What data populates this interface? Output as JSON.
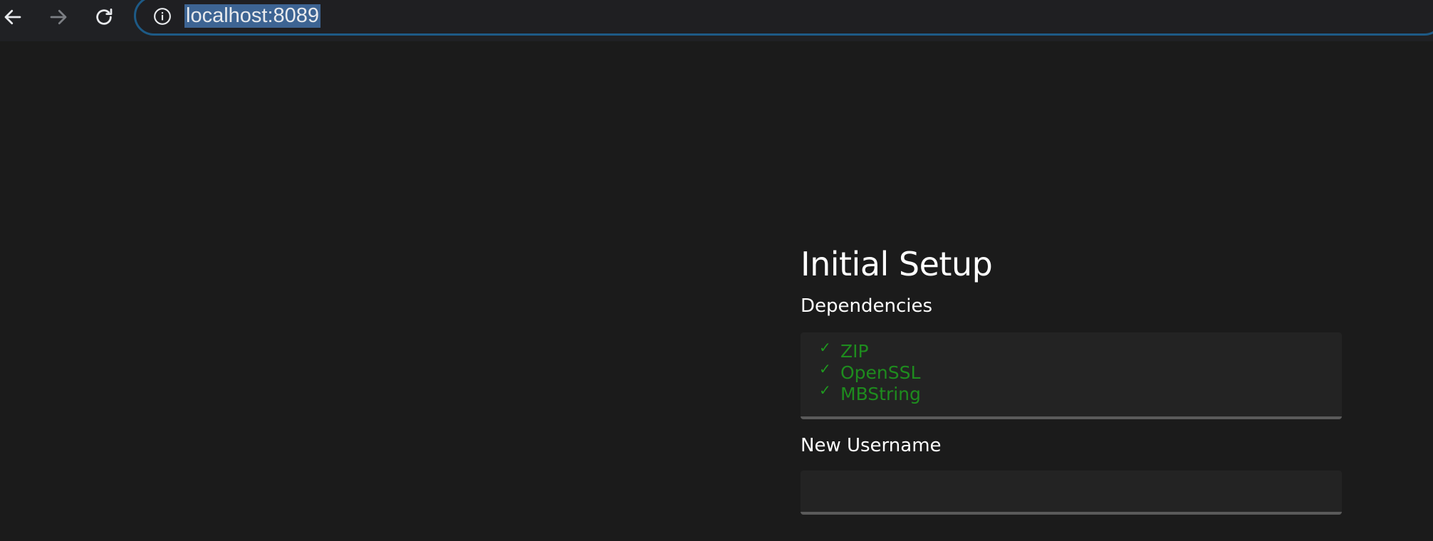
{
  "browser": {
    "address": "localhost:8089",
    "icons": {
      "back": "arrow-left-icon",
      "forward": "arrow-right-icon",
      "reload": "reload-icon",
      "info": "info-circle-icon"
    }
  },
  "page": {
    "title": "Initial Setup",
    "dependencies_label": "Dependencies",
    "dependencies": [
      {
        "name": "ZIP",
        "status": "ok",
        "mark": "✓"
      },
      {
        "name": "OpenSSL",
        "status": "ok",
        "mark": "✓"
      },
      {
        "name": "MBString",
        "status": "ok",
        "mark": "✓"
      }
    ],
    "username_label": "New Username",
    "username_value": ""
  },
  "colors": {
    "page_background": "#1b1b1b",
    "chrome_background": "#202124",
    "address_border": "#1d5a86",
    "url_selection": "#3d6493",
    "dependency_ok": "#1e8c1e",
    "field_background": "#232323",
    "field_underline": "#5a5a5a"
  }
}
